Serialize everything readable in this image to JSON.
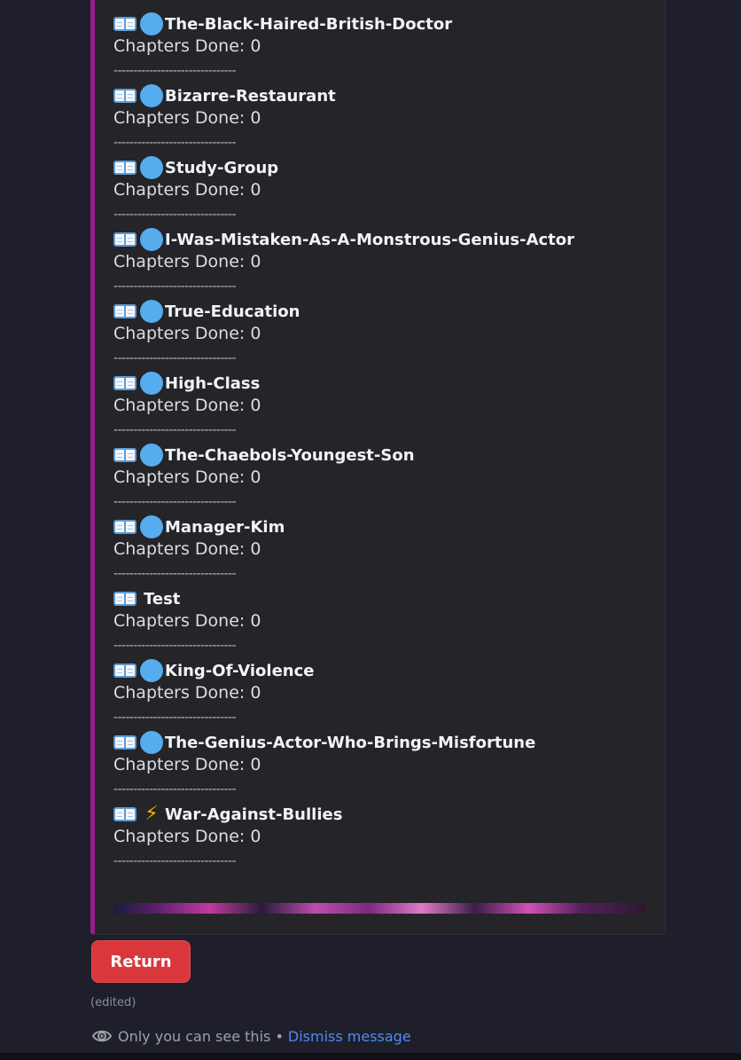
{
  "entries": [
    {
      "title": "The-Black-Haired-British-Doctor",
      "chapters": "Chapters Done: 0",
      "status": "dot"
    },
    {
      "title": "Bizarre-Restaurant",
      "chapters": "Chapters Done: 0",
      "status": "dot"
    },
    {
      "title": "Study-Group",
      "chapters": "Chapters Done: 0",
      "status": "dot"
    },
    {
      "title": "I-Was-Mistaken-As-A-Monstrous-Genius-Actor",
      "chapters": "Chapters Done: 0",
      "status": "dot"
    },
    {
      "title": "True-Education",
      "chapters": "Chapters Done: 0",
      "status": "dot"
    },
    {
      "title": "High-Class",
      "chapters": "Chapters Done: 0",
      "status": "dot"
    },
    {
      "title": "The-Chaebols-Youngest-Son",
      "chapters": "Chapters Done: 0",
      "status": "dot"
    },
    {
      "title": "Manager-Kim",
      "chapters": "Chapters Done: 0",
      "status": "dot"
    },
    {
      "title": "Test",
      "chapters": "Chapters Done: 0",
      "status": "none"
    },
    {
      "title": "King-Of-Violence",
      "chapters": "Chapters Done: 0",
      "status": "dot"
    },
    {
      "title": "The-Genius-Actor-Who-Brings-Misfortune",
      "chapters": "Chapters Done: 0",
      "status": "dot"
    },
    {
      "title": "War-Against-Bullies",
      "chapters": "Chapters Done: 0",
      "status": "bolt"
    }
  ],
  "separator": "-------------------------------",
  "icons": {
    "entry": "open-book-icon",
    "status_dot": "blue-circle-icon",
    "status_bolt": "lightning-icon",
    "eye": "eye-icon"
  },
  "colors": {
    "accent_bar": "#9b1a8c",
    "status_dot": "#55acee",
    "button": "#da373c",
    "link": "#4e8cf0"
  },
  "actions": {
    "return_label": "Return"
  },
  "footer": {
    "edited": "(edited)",
    "ephemeral": "Only you can see this •",
    "dismiss": "Dismiss message"
  }
}
